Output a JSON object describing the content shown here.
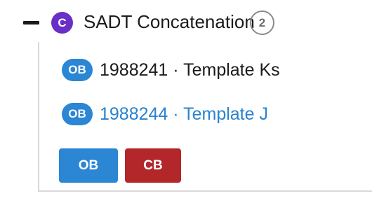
{
  "header": {
    "type_badge": "C",
    "title": "SADT Concatenation",
    "count": "2"
  },
  "items": [
    {
      "badge": "OB",
      "text": "1988241 · Template Ks",
      "is_link": false
    },
    {
      "badge": "OB",
      "text": "1988244 · Template J",
      "is_link": true
    }
  ],
  "actions": {
    "ob_label": "OB",
    "cb_label": "CB"
  },
  "colors": {
    "type_badge": "#6a2fc7",
    "ob_badge": "#2b86d4",
    "link_text": "#2a82cf",
    "cb_button": "#b3272b"
  }
}
